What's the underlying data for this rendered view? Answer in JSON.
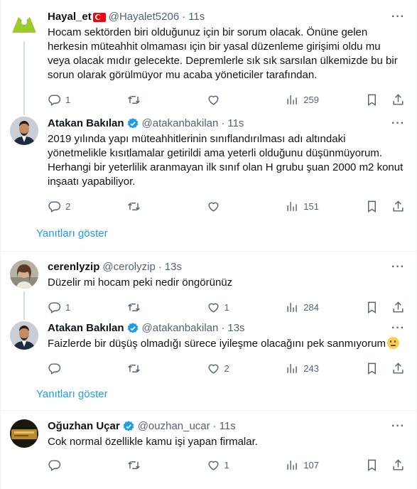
{
  "tweets": [
    {
      "name": "Hayal_et",
      "handle": "@Hayalet5206",
      "sep": "·",
      "time": "11s",
      "text": "Hocam sektörden biri olduğunuz için bir sorum olacak. Önüne gelen herkesin müteahhit olmaması için bir yasal düzenleme girişimi oldu mu veya olacak mıdır gelecekte. Depremlerle sık sık sarsılan ülkemizde bu bir sorun olarak görülmüyor mu acaba yöneticiler tarafından.",
      "replies": "1",
      "retweets": "",
      "likes": "",
      "views": "259"
    },
    {
      "name": "Atakan Bakılan",
      "handle": "@atakanbakilan",
      "sep": "·",
      "time": "11s",
      "text": "2019 yılında yapı müteahhitlerinin sınıflandırılması adı altındaki yönetmelikle kısıtlamalar getirildi ama yeterli olduğunu düşünmüyorum. Herhangi bir yeterlilik aranmayan ilk sınıf olan H grubu şuan 2000 m2 konut inşaatı yapabiliyor.",
      "replies": "2",
      "retweets": "",
      "likes": "",
      "views": "151"
    },
    {
      "name": "cerenlyzip",
      "handle": "@cerolyzip",
      "sep": "·",
      "time": "13s",
      "text": "Düzelir mi hocam peki nedir öngörünüz",
      "replies": "1",
      "retweets": "",
      "likes": "1",
      "views": "284"
    },
    {
      "name": "Atakan Bakılan",
      "handle": "@atakanbakilan",
      "sep": "·",
      "time": "13s",
      "text": "Faizlerde bir düşüş olmadığı sürece iyileşme olacağını pek sanmıyorum",
      "replies": "",
      "retweets": "",
      "likes": "2",
      "views": "243"
    },
    {
      "name": "Oğuzhan Uçar",
      "handle": "@ouzhan_ucar",
      "sep": "·",
      "time": "11s",
      "text": "Cok normal özellikle kamu işi yapan firmalar.",
      "replies": "",
      "retweets": "",
      "likes": "1",
      "views": "107"
    }
  ],
  "show_replies_1": "Yanıtları göster",
  "show_replies_2": "Yanıtları göster",
  "more_glyph": "···",
  "icons": {
    "reply": "reply-icon",
    "retweet": "retweet-icon",
    "like": "heart-icon",
    "views": "views-icon",
    "bookmark": "bookmark-icon",
    "share": "share-icon",
    "verified": "verified-badge-icon"
  },
  "colors": {
    "accent": "#1d9bf0",
    "muted": "#536471",
    "text": "#0f1419",
    "line": "#cfd9de"
  }
}
